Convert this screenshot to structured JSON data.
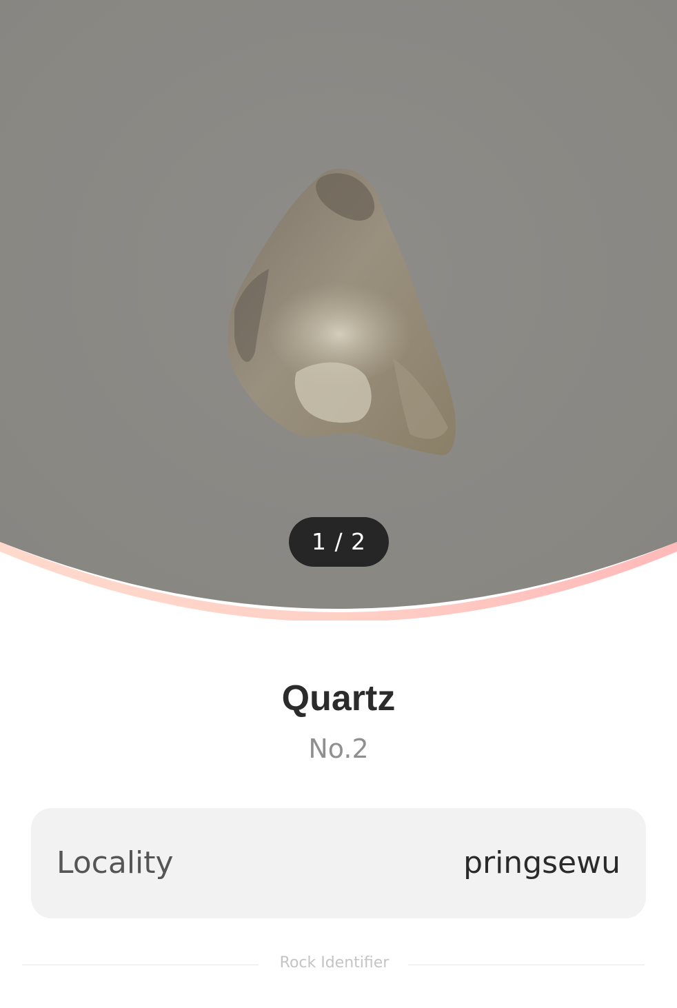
{
  "colors": {
    "hero_background": "#8c8a86",
    "hero_edge_glow": "#ffc7c0",
    "pill_background": "#262626",
    "card_background": "#f2f2f2"
  },
  "gallery": {
    "page_indicator": "1 / 2"
  },
  "specimen": {
    "name": "Quartz",
    "number": "No.2"
  },
  "details": [
    {
      "label": "Locality",
      "value": "pringsewu"
    }
  ],
  "footer": {
    "text": "Rock Identifier"
  }
}
